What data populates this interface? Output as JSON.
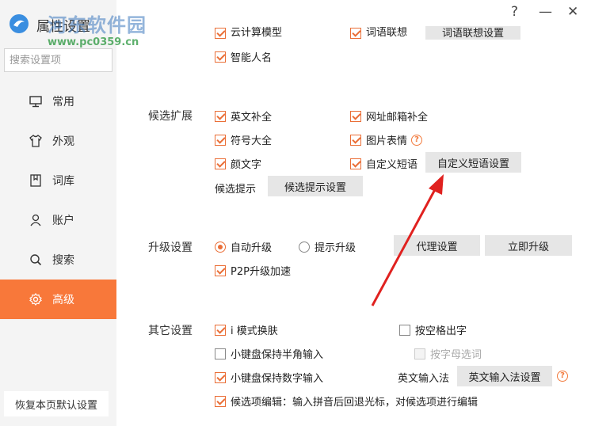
{
  "window": {
    "title": "属性设置",
    "help_glyph": "?",
    "minimize_glyph": "—",
    "close_glyph": "✕"
  },
  "watermark": {
    "brand": "河东软件园",
    "url": "www.pc0359.cn"
  },
  "sidebar": {
    "search_placeholder": "搜索设置项",
    "items": [
      {
        "label": "常用",
        "icon": "monitor-icon"
      },
      {
        "label": "外观",
        "icon": "shirt-icon"
      },
      {
        "label": "词库",
        "icon": "book-icon"
      },
      {
        "label": "账户",
        "icon": "user-icon"
      },
      {
        "label": "搜索",
        "icon": "search-icon"
      },
      {
        "label": "高级",
        "icon": "gear-icon",
        "active": true
      }
    ],
    "restore_label": "恢复本页默认设置"
  },
  "top_partial": {
    "cloud_calc": "云计算模型",
    "phrase_state": "词语联想",
    "phrase_state_btn": "词语联想设置",
    "smart_name": "智能人名"
  },
  "candidates": {
    "label": "候选扩展",
    "english_complete": "英文补全",
    "url_email": "网址邮箱补全",
    "symbols": "符号大全",
    "stickers": "图片表情",
    "emoticons": "颜文字",
    "custom_phrase": "自定义短语",
    "custom_phrase_btn": "自定义短语设置",
    "hint_label": "候选提示",
    "hint_btn": "候选提示设置"
  },
  "upgrade": {
    "label": "升级设置",
    "auto": "自动升级",
    "prompt": "提示升级",
    "proxy_btn": "代理设置",
    "now_btn": "立即升级",
    "p2p": "P2P升级加速"
  },
  "other": {
    "label": "其它设置",
    "i_mode": "i 模式换肤",
    "space_output": "按空格出字",
    "half_width": "小键盘保持半角输入",
    "letter_select": "按字母选词",
    "numeric": "小键盘保持数字输入",
    "en_input_label": "英文输入法",
    "en_input_btn": "英文输入法设置",
    "candidate_edit": "候选项编辑：输入拼音后回退光标，对候选项进行编辑"
  },
  "colors": {
    "accent": "#f8783a",
    "checkbox": "#ea6e36",
    "arrow": "#e0211f"
  }
}
